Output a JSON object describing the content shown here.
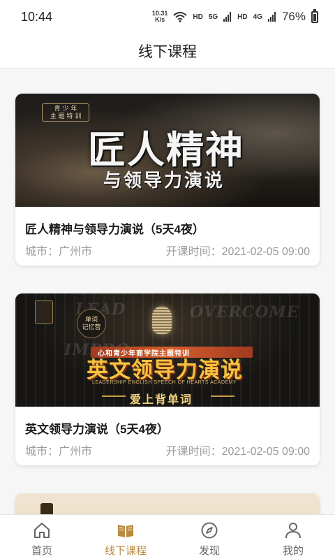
{
  "status_bar": {
    "time": "10:44",
    "net_speed_value": "10.31",
    "net_speed_unit": "K/s",
    "hd1": "HD",
    "sig1": "5G",
    "hd2": "HD",
    "sig2": "4G",
    "battery": "76%"
  },
  "header": {
    "title": "线下课程"
  },
  "courses": [
    {
      "title": "匠人精神与领导力演说（5天4夜）",
      "city": "城市：广州市",
      "start_time": "开课时间：2021-02-05 09:00",
      "banner": {
        "badge_line1": "青 少 年",
        "badge_line2": "主 题 特 训",
        "heading": "匠人精神",
        "subheading": "与领导力演说"
      }
    },
    {
      "title": "英文领导力演说（5天4夜）",
      "city": "城市：广州市",
      "start_time": "开课时间：2021-02-05 09:00",
      "banner": {
        "ghost_1": "LEAD",
        "ghost_2": "OVERCOME",
        "ghost_3": "IMPRO",
        "stamp_line1": "单词",
        "stamp_line2": "记忆营",
        "ribbon": "心和青少年商学院主题特训",
        "heading": "英文领导力演说",
        "tagline": "LEADERSHIP ENGLISH SPEECH OF HEARTS ACADEMY",
        "slogan": "爱上背单词"
      }
    }
  ],
  "tabs": [
    {
      "label": "首页",
      "icon": "home-icon",
      "active": false
    },
    {
      "label": "线下课程",
      "icon": "book-icon",
      "active": true
    },
    {
      "label": "发现",
      "icon": "compass-icon",
      "active": false
    },
    {
      "label": "我的",
      "icon": "user-icon",
      "active": false
    }
  ],
  "colors": {
    "accent": "#b98a3e",
    "tab_inactive": "#666666",
    "meta_text": "#9b9b9b"
  }
}
